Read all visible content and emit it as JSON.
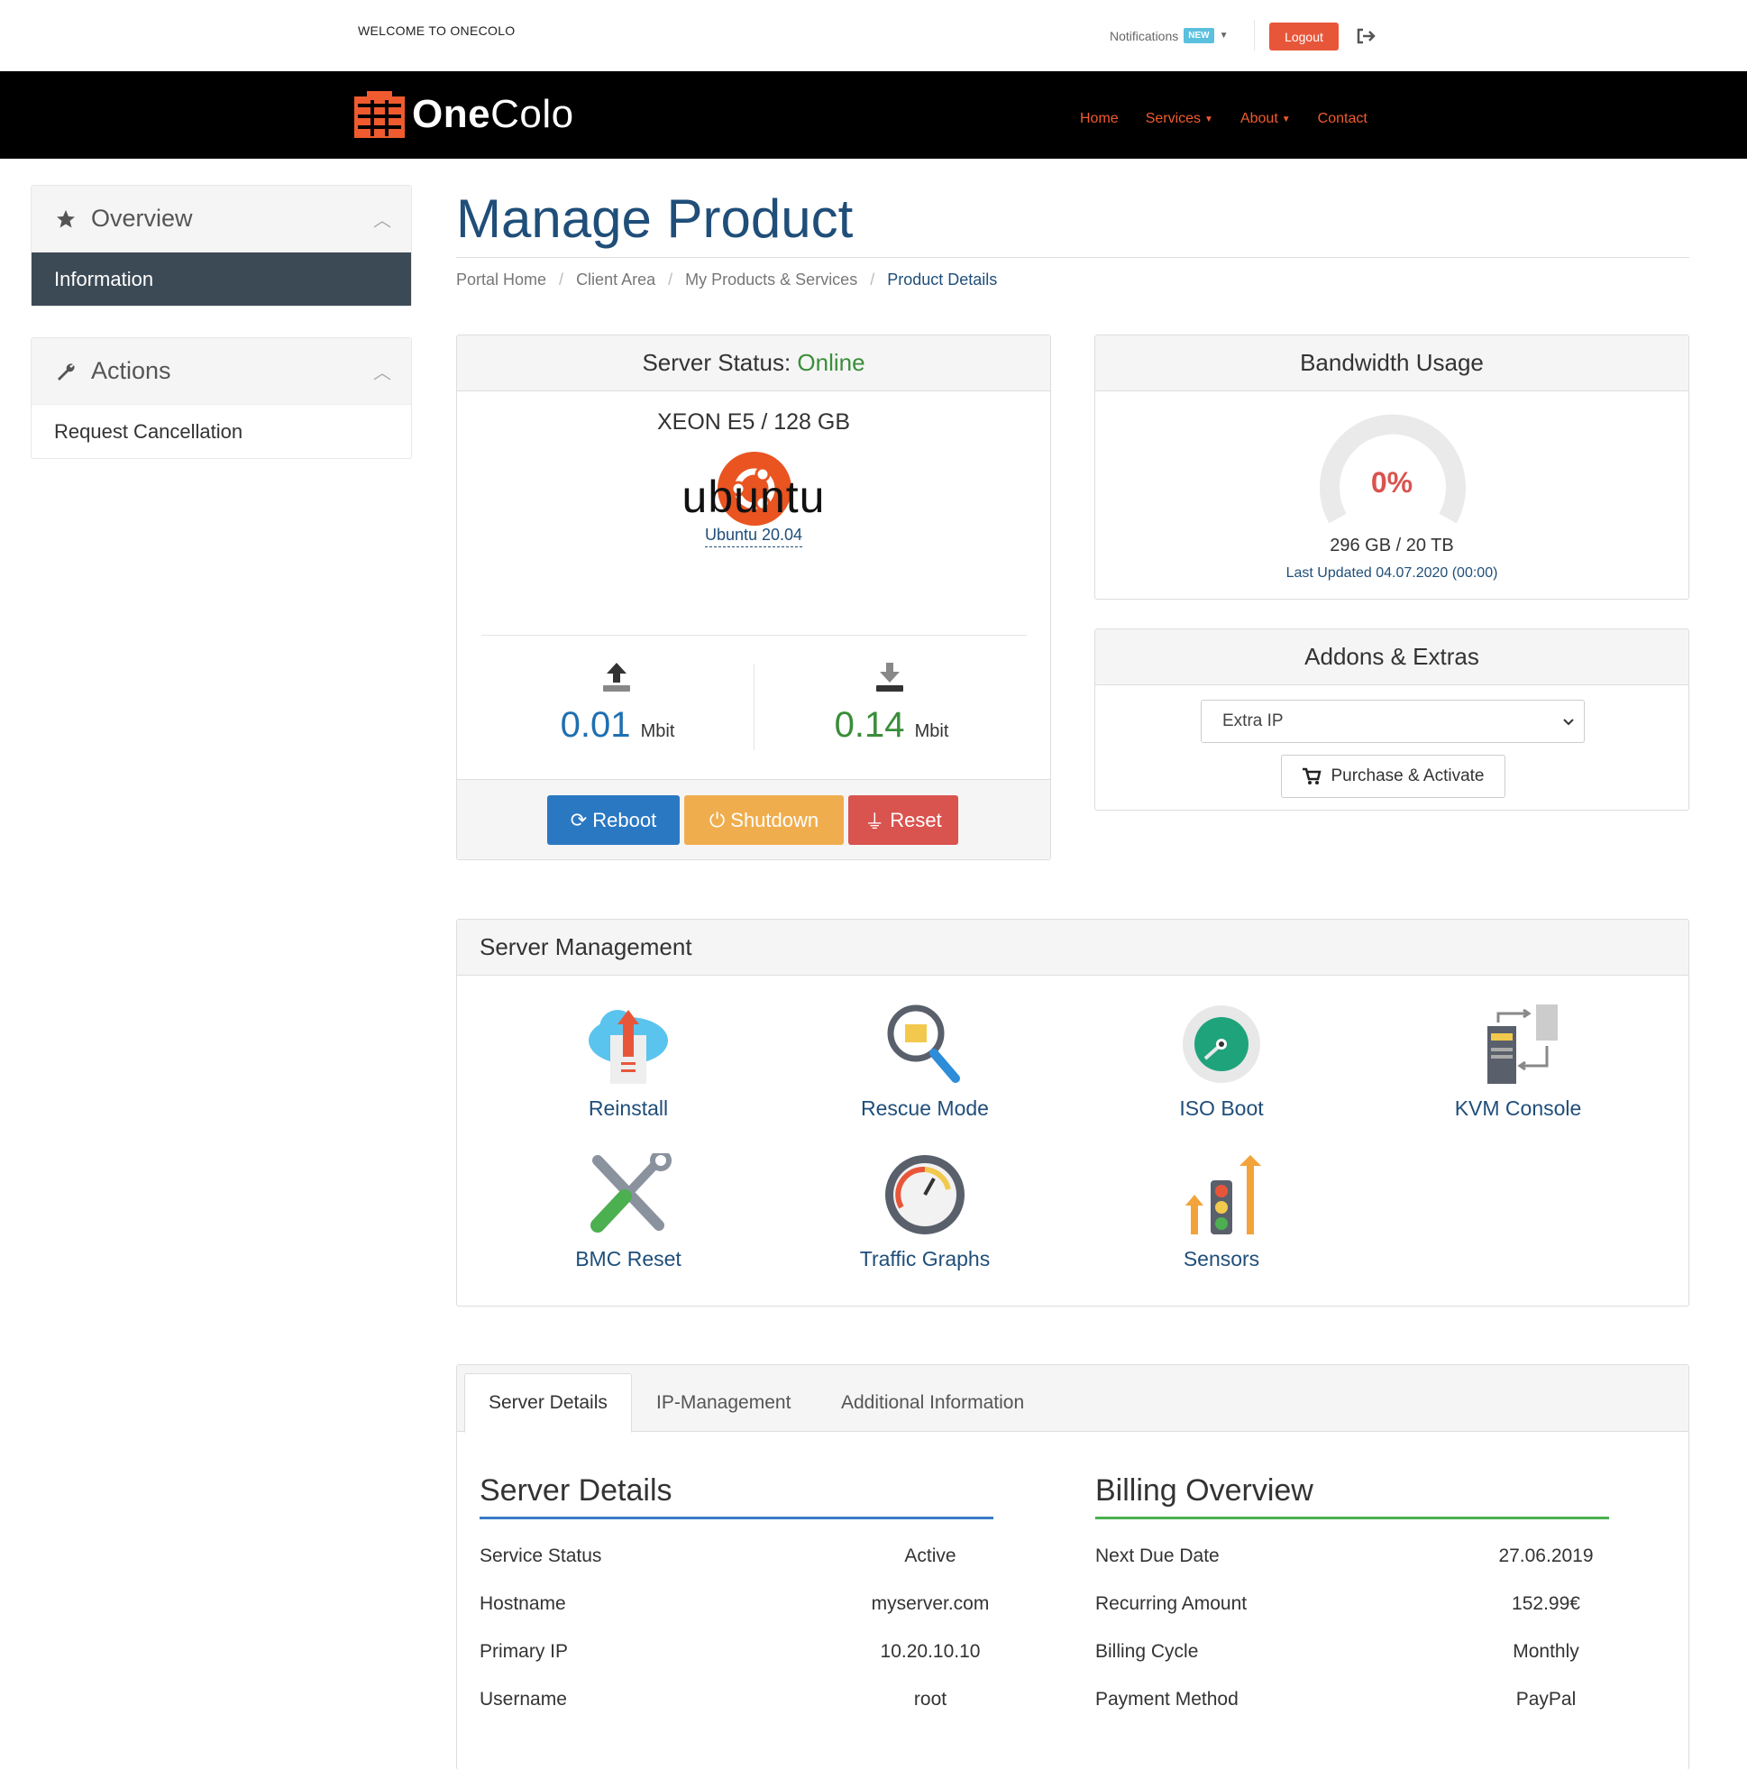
{
  "topbar": {
    "welcome": "WELCOME TO ONECOLO",
    "notifications": "Notifications",
    "notifications_badge": "NEW",
    "logout": "Logout"
  },
  "brand": {
    "name_bold": "One",
    "name_rest": "Colo"
  },
  "nav": {
    "home": "Home",
    "services": "Services",
    "about": "About",
    "contact": "Contact"
  },
  "sidebar": {
    "overview": {
      "title": "Overview",
      "items": [
        "Information"
      ]
    },
    "actions": {
      "title": "Actions",
      "items": [
        "Request Cancellation"
      ]
    }
  },
  "page": {
    "title": "Manage Product",
    "breadcrumb": [
      "Portal Home",
      "Client Area",
      "My Products & Services",
      "Product Details"
    ]
  },
  "server_status": {
    "label": "Server Status:",
    "status": "Online",
    "model": "XEON E5 / 128 GB",
    "os_logo_text": "ubuntu",
    "os": "Ubuntu 20.04",
    "upload_value": "0.01",
    "download_value": "0.14",
    "unit": "Mbit",
    "buttons": {
      "reboot": "Reboot",
      "shutdown": "Shutdown",
      "reset": "Reset"
    }
  },
  "bandwidth": {
    "title": "Bandwidth Usage",
    "percent": "0%",
    "usage": "296 GB / 20 TB",
    "updated": "Last Updated 04.07.2020 (00:00)"
  },
  "addons": {
    "title": "Addons & Extras",
    "selected": "Extra IP",
    "button": "Purchase & Activate"
  },
  "management": {
    "title": "Server Management",
    "tools": [
      "Reinstall",
      "Rescue Mode",
      "ISO Boot",
      "KVM Console",
      "BMC Reset",
      "Traffic Graphs",
      "Sensors"
    ]
  },
  "tabs": [
    "Server Details",
    "IP-Management",
    "Additional Information"
  ],
  "server_details": {
    "title": "Server Details",
    "rows": [
      {
        "k": "Service Status",
        "v": "Active"
      },
      {
        "k": "Hostname",
        "v": "myserver.com"
      },
      {
        "k": "Primary IP",
        "v": "10.20.10.10"
      },
      {
        "k": "Username",
        "v": "root"
      }
    ]
  },
  "billing": {
    "title": "Billing Overview",
    "rows": [
      {
        "k": "Next Due Date",
        "v": "27.06.2019"
      },
      {
        "k": "Recurring Amount",
        "v": "152.99€"
      },
      {
        "k": "Billing Cycle",
        "v": "Monthly"
      },
      {
        "k": "Payment Method",
        "v": "PayPal"
      }
    ]
  },
  "colors": {
    "brand_orange": "#ef5b2e",
    "primary": "#1f4e79",
    "online": "#3a8d3a",
    "reboot": "#2a78c2",
    "shutdown": "#f0ad4e",
    "reset": "#d9534f"
  }
}
